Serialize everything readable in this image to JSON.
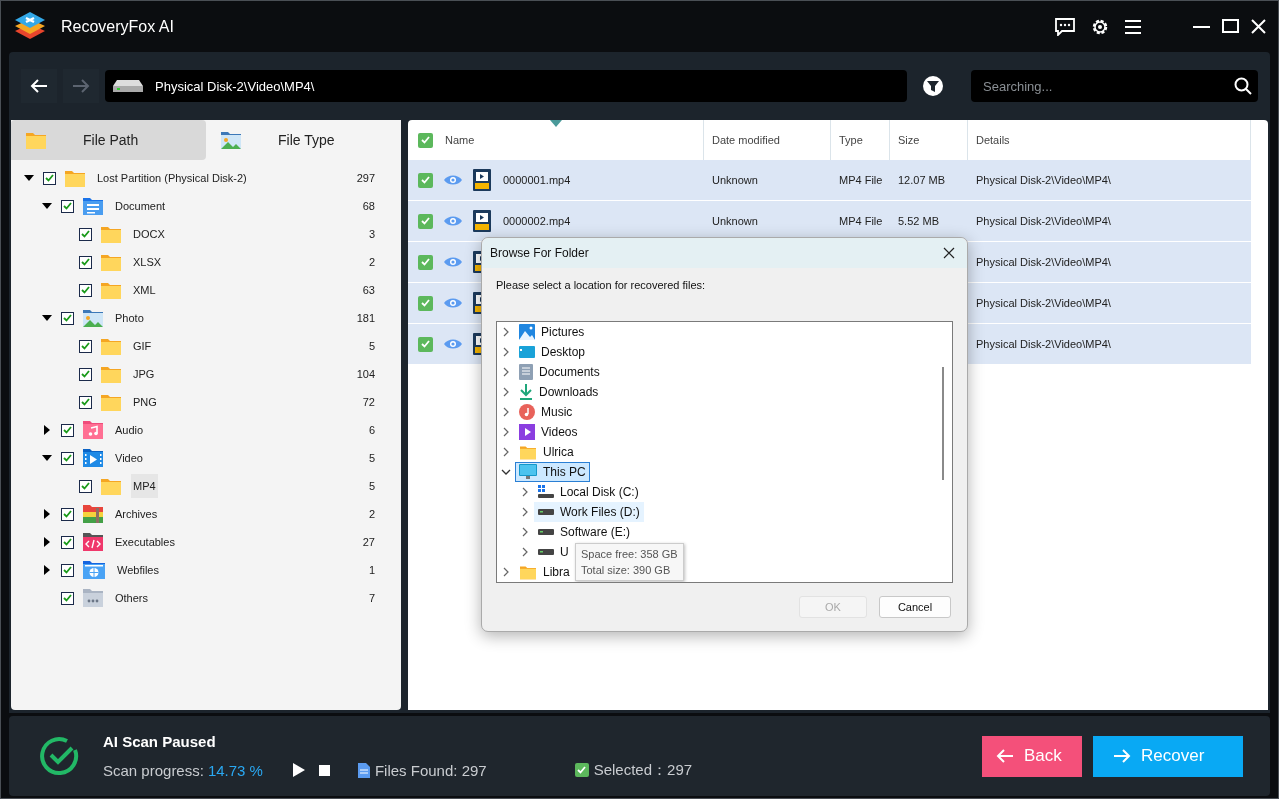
{
  "window": {
    "title": "RecoveryFox AI"
  },
  "toolbar": {
    "back_disabled": false,
    "forward_disabled": true,
    "path": "Physical Disk-2\\Video\\MP4\\",
    "search": {
      "placeholder": "Searching..."
    }
  },
  "left_panel": {
    "tabs": [
      {
        "label": "File Path",
        "kind": "folder",
        "selected": false
      },
      {
        "label": "File Type",
        "kind": "photo",
        "selected": true
      }
    ],
    "tree": [
      {
        "name": "Lost Partition (Physical Disk-2)",
        "count": "297",
        "kind": "folder",
        "checked": true,
        "selected": false,
        "expanded": true,
        "children": [
          {
            "name": "Document",
            "count": "68",
            "kind": "document",
            "checked": true,
            "selected": false,
            "expanded": true,
            "children": [
              {
                "name": "DOCX",
                "count": "3",
                "kind": "folder",
                "checked": true,
                "selected": false
              },
              {
                "name": "XLSX",
                "count": "2",
                "kind": "folder",
                "checked": true,
                "selected": false
              },
              {
                "name": "XML",
                "count": "63",
                "kind": "folder",
                "checked": true,
                "selected": false
              }
            ]
          },
          {
            "name": "Photo",
            "count": "181",
            "kind": "photo",
            "checked": true,
            "selected": false,
            "expanded": true,
            "children": [
              {
                "name": "GIF",
                "count": "5",
                "kind": "folder",
                "checked": true,
                "selected": false
              },
              {
                "name": "JPG",
                "count": "104",
                "kind": "folder",
                "checked": true,
                "selected": false
              },
              {
                "name": "PNG",
                "count": "72",
                "kind": "folder",
                "checked": true,
                "selected": false
              }
            ]
          },
          {
            "name": "Audio",
            "count": "6",
            "kind": "audio",
            "checked": true,
            "selected": false,
            "expanded": false
          },
          {
            "name": "Video",
            "count": "5",
            "kind": "video",
            "checked": true,
            "selected": false,
            "expanded": true,
            "children": [
              {
                "name": "MP4",
                "count": "5",
                "kind": "folder",
                "checked": true,
                "selected": true
              }
            ]
          },
          {
            "name": "Archives",
            "count": "2",
            "kind": "archive",
            "checked": true,
            "selected": false,
            "expanded": false
          },
          {
            "name": "Executables",
            "count": "27",
            "kind": "executable",
            "checked": true,
            "selected": false,
            "expanded": false
          },
          {
            "name": "Webfiles",
            "count": "1",
            "kind": "web",
            "checked": true,
            "selected": false,
            "expanded": false
          },
          {
            "name": "Others",
            "count": "7",
            "kind": "other",
            "checked": true,
            "selected": false
          }
        ]
      }
    ]
  },
  "file_table": {
    "all_checked": true,
    "columns": [
      "Name",
      "Date modified",
      "Type",
      "Size",
      "Details"
    ],
    "rows": [
      {
        "checked": true,
        "selected": true,
        "name": "0000001.mp4",
        "date": "Unknown",
        "type": "MP4 File",
        "size": "12.07 MB",
        "details": "Physical Disk-2\\Video\\MP4\\"
      },
      {
        "checked": true,
        "selected": true,
        "name": "0000002.mp4",
        "date": "Unknown",
        "type": "MP4 File",
        "size": "5.52 MB",
        "details": "Physical Disk-2\\Video\\MP4\\"
      },
      {
        "checked": true,
        "selected": true,
        "details": "Physical Disk-2\\Video\\MP4\\"
      },
      {
        "checked": true,
        "selected": true,
        "details": "Physical Disk-2\\Video\\MP4\\"
      },
      {
        "checked": true,
        "selected": true,
        "details": "Physical Disk-2\\Video\\MP4\\"
      }
    ]
  },
  "dialog": {
    "title": "Browse For Folder",
    "message": "Please select a location for recovered files:",
    "tree": [
      {
        "name": "Pictures",
        "kind": "pictures",
        "expanded": false,
        "selected": false
      },
      {
        "name": "Desktop",
        "kind": "desktop",
        "expanded": false,
        "selected": false
      },
      {
        "name": "Documents",
        "kind": "documents",
        "expanded": false,
        "selected": false
      },
      {
        "name": "Downloads",
        "kind": "downloads",
        "expanded": false,
        "selected": false
      },
      {
        "name": "Music",
        "kind": "music",
        "expanded": false,
        "selected": false
      },
      {
        "name": "Videos",
        "kind": "videos",
        "expanded": false,
        "selected": false
      },
      {
        "name": "Ulrica",
        "kind": "folder",
        "expanded": false,
        "selected": false
      },
      {
        "name": "This PC",
        "kind": "pc",
        "expanded": true,
        "selected": true,
        "children": [
          {
            "name": "Local Disk (C:)",
            "kind": "system_drive",
            "expanded": false,
            "selected": false
          },
          {
            "name": "Work Files (D:)",
            "kind": "drive",
            "expanded": false,
            "selected": false,
            "hovered": true
          },
          {
            "name": "Software (E:)",
            "kind": "drive",
            "expanded": false,
            "selected": false
          },
          {
            "name": "U",
            "kind": "drive",
            "expanded": false,
            "selected": false
          }
        ]
      },
      {
        "name": "Libra",
        "kind": "folder",
        "expanded": false,
        "selected": false
      }
    ],
    "tooltip": [
      "Space free: 358 GB",
      "Total size: 390 GB"
    ],
    "buttons": [
      {
        "label": "OK",
        "disabled": true
      },
      {
        "label": "Cancel",
        "disabled": false
      }
    ]
  },
  "status": {
    "title": "AI Scan Paused",
    "progress_label": "Scan progress:",
    "progress_value": "14.73 %",
    "files_found": "Files Found: 297",
    "selected_checked": true,
    "selected_text": "Selected：297",
    "buttons": [
      {
        "label": "Back",
        "kind": "back"
      },
      {
        "label": "Recover",
        "kind": "recover"
      }
    ]
  }
}
